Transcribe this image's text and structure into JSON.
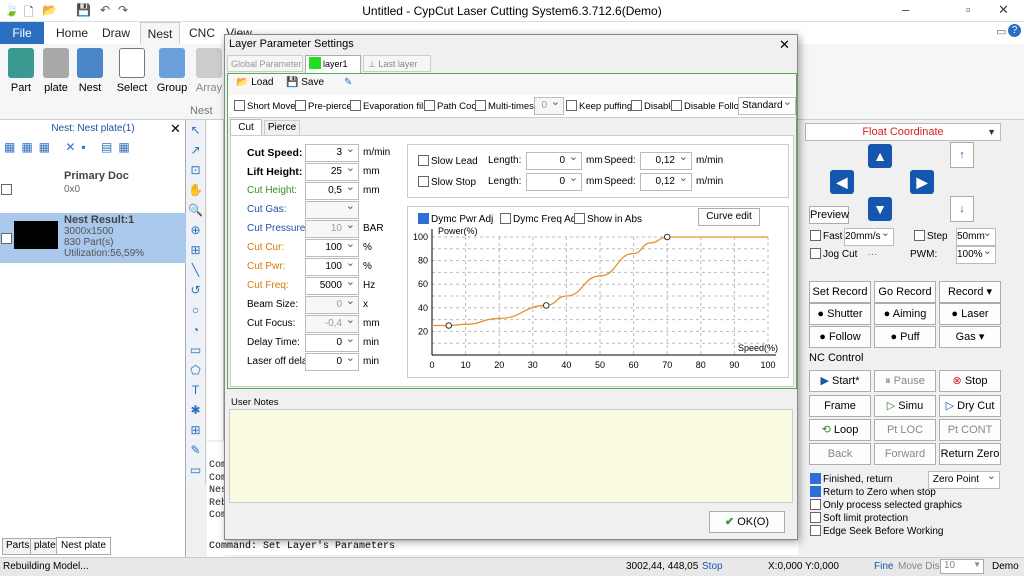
{
  "app": {
    "title": "Untitled - CypCut Laser Cutting System6.3.712.6(Demo)"
  },
  "ribbon": {
    "tabs": [
      "File",
      "Home",
      "Draw",
      "Nest",
      "CNC",
      "View"
    ],
    "buttons": [
      "Part",
      "plate",
      "Nest",
      "Select",
      "Group",
      "Array"
    ],
    "group_label": "Nest"
  },
  "leftpanel": {
    "header": "Nest: Nest plate(1)",
    "primary": {
      "title": "Primary Doc",
      "size": "0x0"
    },
    "result": {
      "title": "Nest Result:1",
      "size": "3000x1500",
      "parts": "830 Part(s)",
      "util": "Utilization:56,59%"
    },
    "tabs": [
      "Parts",
      "plate",
      "Nest plate"
    ]
  },
  "dialog": {
    "title": "Layer Parameter Settings",
    "tabs": [
      "Global Parameter",
      "layer1",
      "Last layer"
    ],
    "toolbar": {
      "load": "Load",
      "save": "Save"
    },
    "options": {
      "short_move": "Short Move",
      "pre_pierce": "Pre-pierce",
      "evap": "Evaporation film",
      "cool": "Path Cool",
      "multi": "Multi-times",
      "multi_val": "0",
      "keep": "Keep puffing",
      "disable": "Disable",
      "disable_follow": "Disable Follow",
      "mode": "Standard"
    },
    "subtabs": [
      "Cut",
      "Pierce"
    ],
    "params": [
      {
        "label": "Cut Speed:",
        "value": "3",
        "unit": "m/min",
        "bold": true
      },
      {
        "label": "Lift Height:",
        "value": "25",
        "unit": "mm",
        "bold": true
      },
      {
        "label": "Cut Height:",
        "value": "0,5",
        "unit": "mm",
        "color": "#3b8a2a"
      },
      {
        "label": "Cut Gas:",
        "value": "",
        "unit": "",
        "color": "#2250a8",
        "dis": true
      },
      {
        "label": "Cut Pressure:",
        "value": "10",
        "unit": "BAR",
        "color": "#2250a8",
        "dis": true
      },
      {
        "label": "Cut Cur:",
        "value": "100",
        "unit": "%",
        "color": "#d67a00"
      },
      {
        "label": "Cut Pwr:",
        "value": "100",
        "unit": "%",
        "color": "#d67a00"
      },
      {
        "label": "Cut Freq:",
        "value": "5000",
        "unit": "Hz",
        "color": "#d67a00"
      },
      {
        "label": "Beam Size:",
        "value": "0",
        "unit": "x",
        "dis": true
      },
      {
        "label": "Cut Focus:",
        "value": "-0,4",
        "unit": "mm",
        "dis": true
      },
      {
        "label": "Delay Time:",
        "value": "0",
        "unit": "min"
      },
      {
        "label": "Laser off delay",
        "value": "0",
        "unit": "min"
      }
    ],
    "lead": {
      "slow_lead": "Slow Lead",
      "slow_stop": "Slow Stop",
      "length": "Length:",
      "len1": "0",
      "len2": "0",
      "mm": "mm",
      "speed": "Speed:",
      "sp1": "0,12",
      "sp2": "0,12",
      "unit": "m/min"
    },
    "curve_opts": {
      "dymc_pwr": "Dymc Pwr Adj",
      "dymc_freq": "Dymc Freq Adj",
      "show_abs": "Show in Abs",
      "curve_edit": "Curve edit"
    },
    "notes_label": "User Notes",
    "ok": "OK(O)"
  },
  "chart_data": {
    "type": "line",
    "xlabel": "Speed(%)",
    "ylabel": "Power(%)",
    "xlim": [
      0,
      100
    ],
    "ylim": [
      0,
      100
    ],
    "xticks": [
      "0",
      "10",
      "20",
      "30",
      "40",
      "50",
      "60",
      "70",
      "80",
      "90",
      "100"
    ],
    "yticks": [
      "20",
      "40",
      "60",
      "80",
      "100"
    ],
    "x": [
      0,
      5,
      10,
      20,
      34,
      40,
      50,
      60,
      65,
      70,
      80,
      90,
      100
    ],
    "y": [
      25,
      25,
      26,
      31,
      42,
      50,
      67,
      86,
      95,
      100,
      100,
      100,
      100
    ],
    "control_points": [
      {
        "x": 5,
        "y": 25
      },
      {
        "x": 34,
        "y": 42
      },
      {
        "x": 70,
        "y": 100
      }
    ],
    "color": "#e8902a"
  },
  "rightpanel": {
    "coord": "Float Coordinate",
    "preview": "Preview",
    "fast": "Fast",
    "fast_val": "20mm/s",
    "step": "Step",
    "step_val": "50mm",
    "jog": "Jog Cut",
    "pwm": "PWM:",
    "pwm_val": "100%",
    "rec_btns": [
      "Set Record",
      "Go Record",
      "Record"
    ],
    "io": [
      "Shutter",
      "Aiming",
      "Laser",
      "Follow",
      "Puff",
      "Gas"
    ],
    "nc": "NC Control",
    "nc_btns": [
      "Start*",
      "Pause",
      "Stop",
      "Frame",
      "Simu",
      "Dry Cut",
      "Loop",
      "Pt LOC",
      "Pt CONT",
      "Back",
      "Forward",
      "Return Zero"
    ],
    "checks": [
      "Finished, return",
      "Return to Zero when stop",
      "Only process selected graphics",
      "Soft limit protection",
      "Edge Seek Before Working"
    ],
    "zero_point": "Zero Point"
  },
  "console": {
    "lines": [
      "Com",
      "Com",
      "Nes",
      "Reb",
      "Com"
    ],
    "last": "Command: Set Layer's Parameters"
  },
  "status": {
    "left": "Rebuilding Model...",
    "coord": "3002,44, 448,05",
    "stop": "Stop",
    "xy": "X:0,000 Y:0,000",
    "fine": "Fine",
    "move_dis": "Move Dis",
    "move_val": "10",
    "demo": "Demo"
  }
}
